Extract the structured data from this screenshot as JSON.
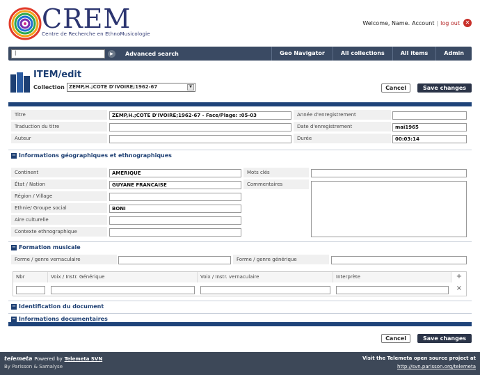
{
  "header": {
    "logo_title": "CREM",
    "logo_subtitle": "Centre de Recherche en EthnoMusicologie",
    "welcome": "Welcome, Name.",
    "account": "Account",
    "separator": "|",
    "logout": "log out"
  },
  "nav": {
    "search_placeholder": "|",
    "advanced_search": "Advanced search",
    "items": [
      "Geo Navigator",
      "All collections",
      "All items",
      "Admin"
    ]
  },
  "page": {
    "title": "ITEM/edit",
    "collection_label": "Collection",
    "collection_value": "ZEMP,H.;COTE D'IVOIRE;1962-67",
    "cancel": "Cancel",
    "save": "Save changes"
  },
  "general": {
    "titre_label": "Titre",
    "titre_value": "ZEMP,H.;COTE D'IVOIRE;1962-67 - Face/Plage: :05-03",
    "traduction_label": "Traduction du titre",
    "traduction_value": "",
    "auteur_label": "Auteur",
    "auteur_value": "",
    "annee_label": "Année d'enregistrement",
    "annee_value": "",
    "date_label": "Date d'enregistrement",
    "date_value": "mai1965",
    "duree_label": "Durée",
    "duree_value": "00:03:14"
  },
  "geo": {
    "heading": "Informations géographiques et ethnographiques",
    "continent_label": "Continent",
    "continent_value": "AMERIQUE",
    "etat_label": "État / Nation",
    "etat_value": "GUYANE FRANCAISE",
    "region_label": "Région / Village",
    "region_value": "",
    "ethnie_label": "Ethnie/ Groupe social",
    "ethnie_value": "BONI",
    "aire_label": "Aire culturelle",
    "aire_value": "",
    "contexte_label": "Contexte ethnographique",
    "contexte_value": "",
    "motscles_label": "Mots clés",
    "commentaires_label": "Commentaires"
  },
  "formation": {
    "heading": "Formation musicale",
    "forme_vern_label": "Forme / genre vernaculaire",
    "forme_gen_label": "Forme / genre générique",
    "columns": [
      "Nbr",
      "Voix / Instr. Générique",
      "Voix / Instr. vernaculaire",
      "Interprète"
    ]
  },
  "sections": {
    "identification": "Identification du document",
    "documentaires": "Informations documentaires"
  },
  "footer": {
    "brand": "telemeta",
    "powered": "Powered by",
    "powered_link": "Telemeta SVN",
    "by": "By",
    "by_link": "Parisson & Samalyse",
    "visit": "Visit the Telemeta open source project at",
    "url": "http://svn.parisson.org/telemeta"
  }
}
